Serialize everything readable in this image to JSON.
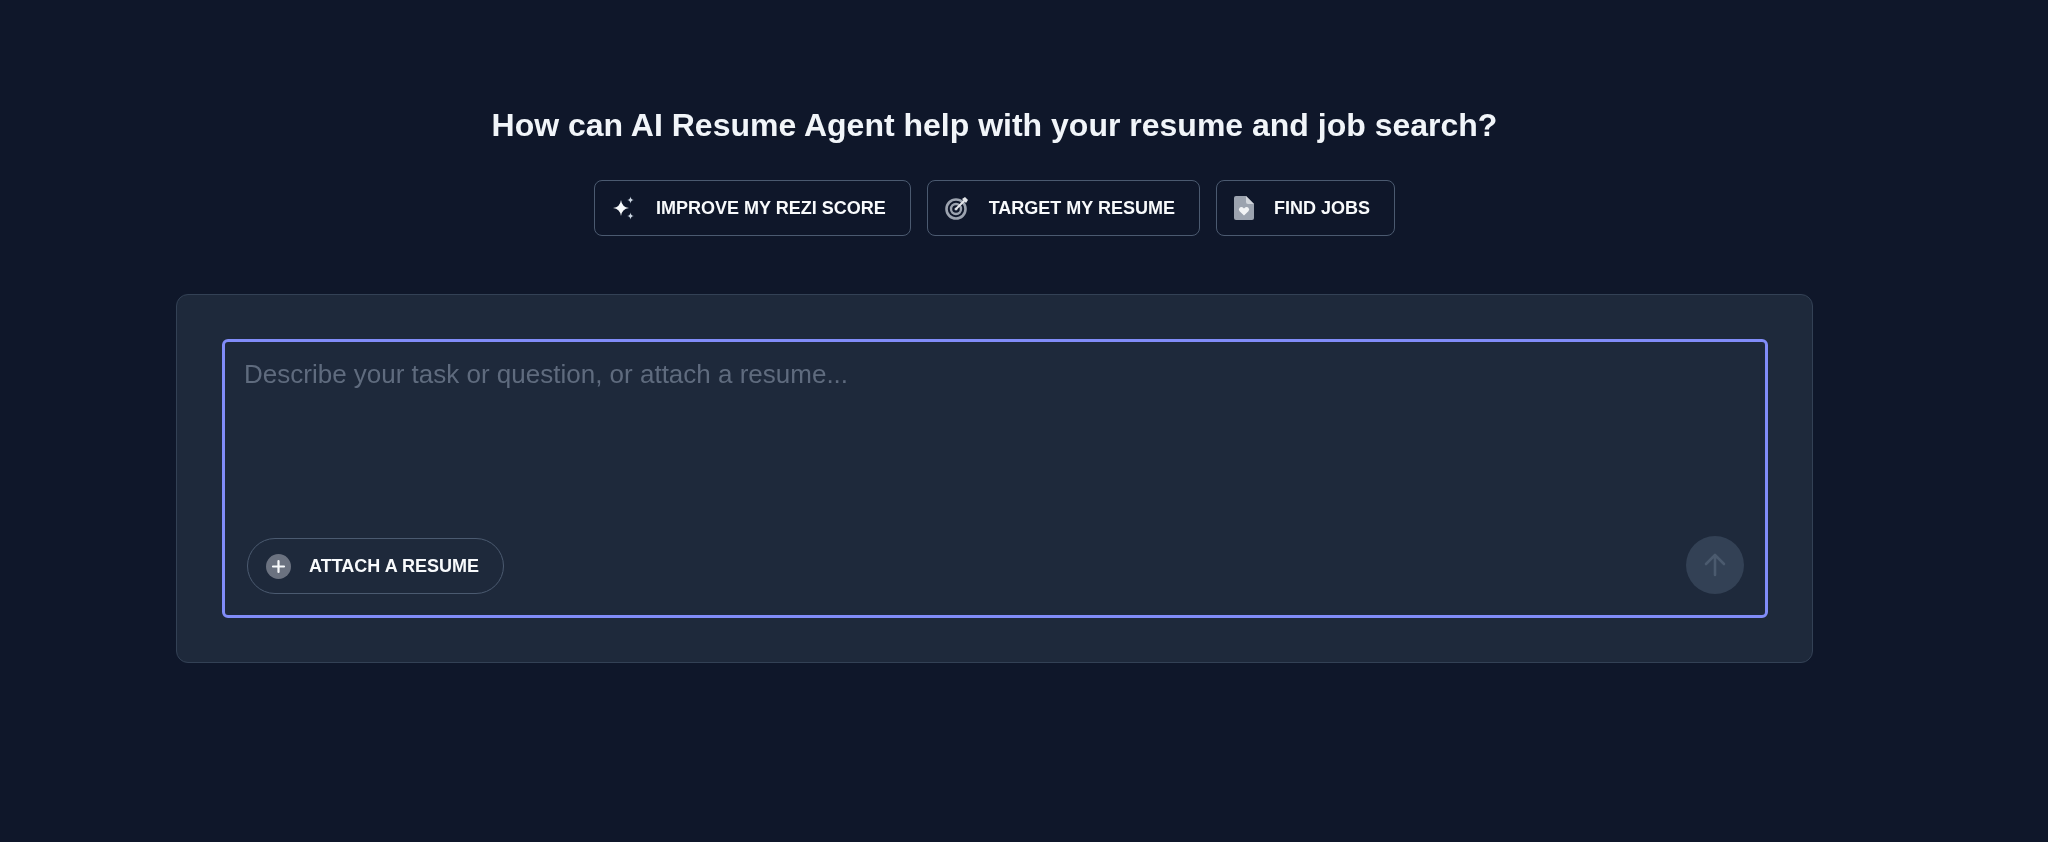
{
  "heading": "How can AI Resume Agent help with your resume and job search?",
  "quick_actions": [
    {
      "label": "IMPROVE MY REZI SCORE",
      "kind": "sparkle"
    },
    {
      "label": "TARGET MY RESUME",
      "kind": "target"
    },
    {
      "label": "FIND JOBS",
      "kind": "file"
    }
  ],
  "composer": {
    "placeholder": "Describe your task or question, or attach a resume...",
    "focused": true,
    "attach_button": "ATTACH A RESUME",
    "send_disabled": true
  }
}
